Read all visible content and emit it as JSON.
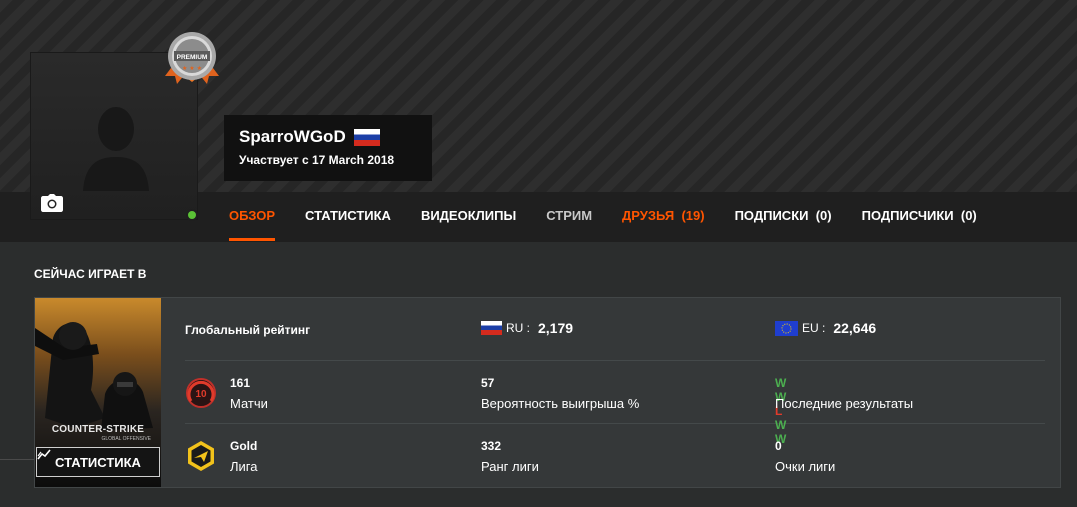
{
  "profile": {
    "username": "SparroWGoD",
    "member_since": "Участвует с 17 March 2018",
    "premium_badge_text": "PREMIUM",
    "online_status_color": "#5bc236"
  },
  "tabs": [
    {
      "label": "ОБЗОР",
      "state": "active"
    },
    {
      "label": "СТАТИСТИКА",
      "state": "normal"
    },
    {
      "label": "ВИДЕОКЛИПЫ",
      "state": "normal"
    },
    {
      "label": "СТРИМ",
      "state": "muted"
    },
    {
      "label": "ДРУЗЬЯ  (19)",
      "state": "highlight"
    },
    {
      "label": "ПОДПИСКИ  (0)",
      "state": "normal"
    },
    {
      "label": "ПОДПИСЧИКИ  (0)",
      "state": "normal"
    }
  ],
  "now_playing": {
    "section_title": "СЕЙЧАС ИГРАЕТ В",
    "game_logo": "COUNTER-STRIKE",
    "game_logo_sub": "GLOBAL OFFENSIVE",
    "stats_button": "СТАТИСТИКА",
    "global_rating": {
      "label": "Глобальный рейтинг",
      "ru_code": "RU :",
      "ru_value": "2,179",
      "eu_code": "EU :",
      "eu_value": "22,646"
    },
    "matches": {
      "value": "161",
      "label": "Матчи",
      "level_badge": "10"
    },
    "win_probability": {
      "value": "57",
      "label": "Вероятность выигрыша %"
    },
    "recent_results": {
      "label": "Последние результаты",
      "results": [
        "W",
        "W",
        "L",
        "W",
        "W"
      ]
    },
    "league": {
      "value": "Gold",
      "label": "Лига"
    },
    "league_rank": {
      "value": "332",
      "label": "Ранг лиги"
    },
    "league_points": {
      "value": "0",
      "label": "Очки лиги"
    }
  },
  "colors": {
    "accent": "#ff5500",
    "win": "#4caf50",
    "loss": "#e03b2b",
    "league_gold": "#f2c21b"
  }
}
